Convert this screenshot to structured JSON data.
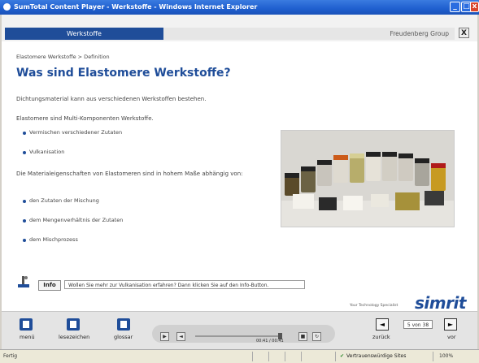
{
  "window": {
    "title": "SumTotal Content Player - Werkstoffe - Windows Internet Explorer"
  },
  "header": {
    "tab_label": "Werkstoffe",
    "group_label": "Freudenberg Group",
    "close_label": "X"
  },
  "main": {
    "breadcrumb": "Elastomere Werkstoffe > Definition",
    "title": "Was sind Elastomere Werkstoffe?",
    "para1": "Dichtungsmaterial kann aus verschiedenen Werkstoffen bestehen.",
    "para2": "Elastomere sind Multi-Komponenten Werkstoffe.",
    "list1": [
      "Vermischen verschiedener Zutaten",
      "Vulkanisation"
    ],
    "para3": "Die Materialeigenschaften von Elastomeren sind in hohem Maße abhängig von:",
    "list2": [
      "den Zutaten der Mischung",
      "dem Mengenverhältnis der Zutaten",
      "dem Mischprozess"
    ]
  },
  "info": {
    "button_label": "Info",
    "text": "Wollen Sie mehr zur Vulkanisation erfahren? Dann klicken Sie auf den Info-Button."
  },
  "brand": {
    "tagline": "Your Technology Specialist",
    "logo": "simrit"
  },
  "footer": {
    "menu_label": "menü",
    "bookmark_label": "lesezeichen",
    "glossary_label": "glossar",
    "time": "00:41 / 00:41",
    "back_label": "zurück",
    "next_label": "vor",
    "page": "5 von 38"
  },
  "statusbar": {
    "left": "Fertig",
    "zone": "Vertrauenswürdige Sites",
    "zoom": "100%"
  },
  "colors": {
    "accent": "#1f4d99",
    "titlebar": "#1f5fcf"
  }
}
